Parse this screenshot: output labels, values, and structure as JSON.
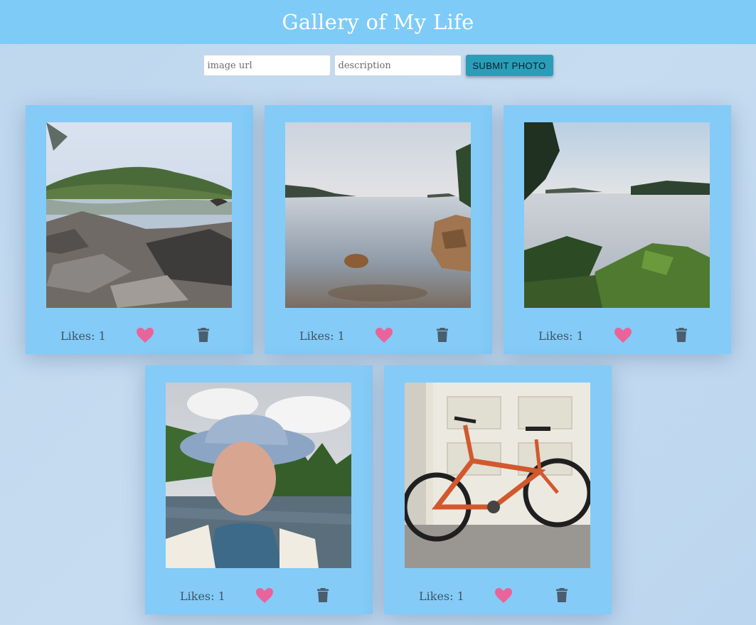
{
  "header": {
    "title": "Gallery of My Life"
  },
  "form": {
    "url_placeholder": "image url",
    "description_placeholder": "description",
    "submit_label": "SUBMIT PHOTO"
  },
  "photos": [
    {
      "likes_label": "Likes: 1",
      "subject": "rocky lake shore with forested hill"
    },
    {
      "likes_label": "Likes: 1",
      "subject": "calm lake with rocks in water"
    },
    {
      "likes_label": "Likes: 1",
      "subject": "misty lake with islands and shrubs"
    },
    {
      "likes_label": "Likes: 1",
      "subject": "selfie in bucket hat by a lake"
    },
    {
      "likes_label": "Likes: 1",
      "subject": "orange mountain bike by garage door"
    }
  ],
  "colors": {
    "header_bg": "#7ecbf8",
    "card_bg": "#84cbf7",
    "button_bg": "#2a9db9",
    "heart": "#e8649a",
    "trash": "#4a5e6e",
    "likes_text": "#3f5566"
  },
  "icons": {
    "like": "heart-icon",
    "delete": "trash-icon"
  }
}
